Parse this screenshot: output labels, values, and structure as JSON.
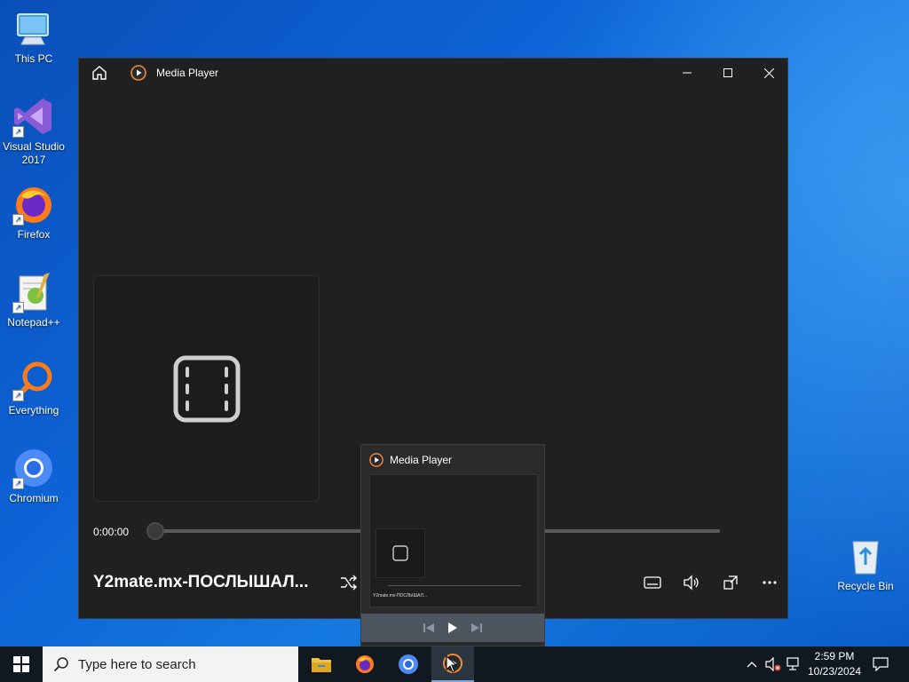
{
  "desktop": {
    "icons": [
      {
        "label": "This PC",
        "icon": "this-pc-icon"
      },
      {
        "label": "Visual Studio 2017",
        "icon": "visual-studio-icon"
      },
      {
        "label": "Firefox",
        "icon": "firefox-icon"
      },
      {
        "label": "Notepad++",
        "icon": "notepad-plus-plus-icon"
      },
      {
        "label": "Everything",
        "icon": "everything-icon"
      },
      {
        "label": "Chromium",
        "icon": "chromium-icon"
      },
      {
        "label": "Recycle Bin",
        "icon": "recycle-bin-icon"
      }
    ]
  },
  "media_player": {
    "title": "Media Player",
    "current_time": "0:00:00",
    "progress": 0,
    "track_title": "Y2mate.mx-ПОСЛЫШАЛ...",
    "controls": [
      "shuffle-icon",
      "captions-icon",
      "volume-icon",
      "miniplayer-icon",
      "more-icon"
    ]
  },
  "thumbnail_preview": {
    "title": "Media Player",
    "mini_track_title": "Y2mate.mx-ПОСЛЫШАЛ..."
  },
  "taskbar": {
    "search_placeholder": "Type here to search",
    "pinned_apps": [
      "file-explorer-icon",
      "firefox-icon",
      "chromium-icon",
      "media-player-icon"
    ],
    "clock": {
      "time": "2:59 PM",
      "date": "10/23/2024"
    }
  },
  "colors": {
    "window_bg": "#202020",
    "taskbar_bg": "#101820",
    "accent": "#0078d4"
  }
}
